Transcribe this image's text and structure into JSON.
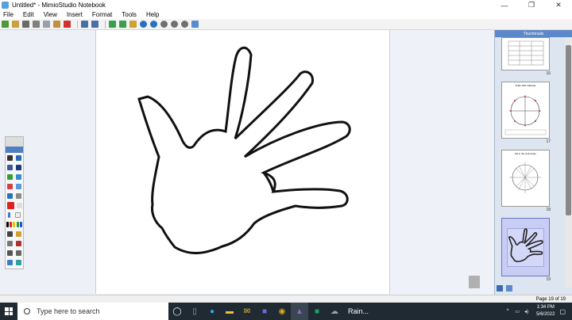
{
  "window": {
    "title": "Untitled* - MimioStudio Notebook",
    "minimize": "—",
    "restore": "❐",
    "close": "✕"
  },
  "menu": [
    "File",
    "Edit",
    "View",
    "Insert",
    "Format",
    "Tools",
    "Help"
  ],
  "sidebar": {
    "header": "Thumbnails",
    "thumbs": [
      {
        "num": "16"
      },
      {
        "num": "17"
      },
      {
        "num": "18"
      },
      {
        "num": "19"
      }
    ],
    "thumb18_title": "Fill in the Unit Circle",
    "thumb17_title": "THE UNIT CIRCLE"
  },
  "status": {
    "page_info": "Page 19 of 19"
  },
  "taskbar": {
    "search_placeholder": "Type here to search",
    "weather": "Rain...",
    "time": "1:34 PM",
    "date": "5/6/2022",
    "app_icons": [
      "task-view-icon",
      "file-explorer-icon",
      "edge-icon",
      "folder-icon",
      "mail-icon",
      "teams-icon",
      "chrome-icon",
      "mimio-icon",
      "excel-icon"
    ]
  },
  "colors": {
    "taskbar": "#1f2a33",
    "selected_thumb": "#c8cdf4",
    "palette_red": "#e02020"
  }
}
